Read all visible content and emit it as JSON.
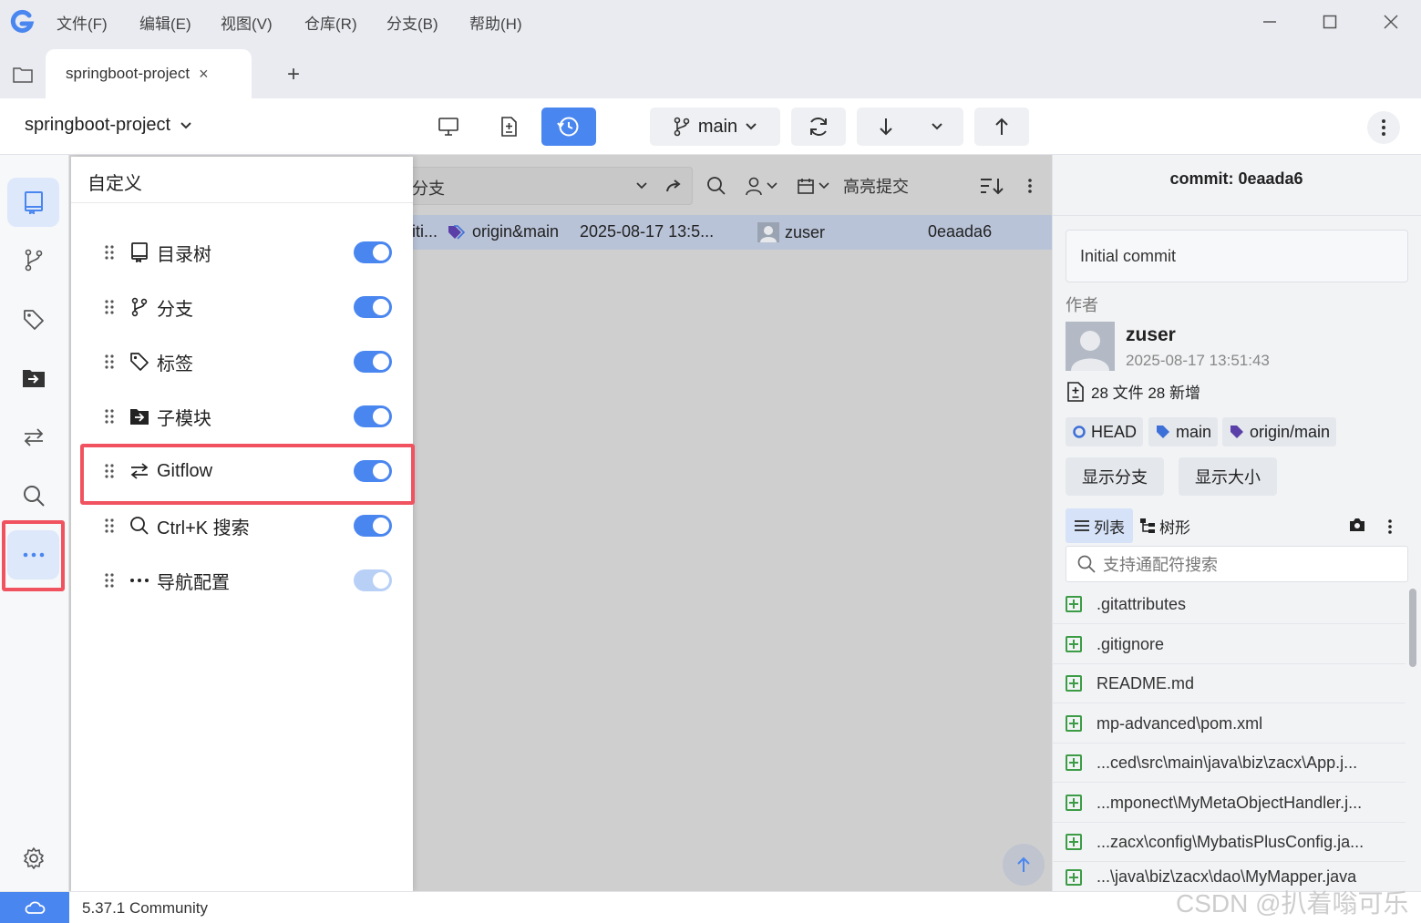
{
  "menu": [
    "文件(F)",
    "编辑(E)",
    "视图(V)",
    "仓库(R)",
    "分支(B)",
    "帮助(H)"
  ],
  "tab": {
    "title": "springboot-project",
    "close": "×",
    "new": "+"
  },
  "toolbar": {
    "repo": "springboot-project",
    "branch": "main"
  },
  "customize": {
    "title": "自定义",
    "items": [
      {
        "label": "目录树",
        "enabled": true
      },
      {
        "label": "分支",
        "enabled": true
      },
      {
        "label": "标签",
        "enabled": true
      },
      {
        "label": "子模块",
        "enabled": true
      },
      {
        "label": "Gitflow",
        "enabled": true
      },
      {
        "label": "Ctrl+K 搜索",
        "enabled": true
      },
      {
        "label": "导航配置",
        "enabled": true,
        "locked": true
      }
    ]
  },
  "filter": {
    "label": "分支",
    "highlight": "高亮提交"
  },
  "commit_row": {
    "message": "iti...",
    "refs": "origin&main",
    "date": "2025-08-17 13:5...",
    "author": "zuser",
    "hash": "0eaada6"
  },
  "detail": {
    "header": "commit: 0eaada6",
    "message": "Initial commit",
    "author_label": "作者",
    "author": "zuser",
    "date": "2025-08-17 13:51:43",
    "summary": "28 文件 28 新增",
    "refs": [
      "HEAD",
      "main",
      "origin/main"
    ],
    "btn_branches": "显示分支",
    "btn_size": "显示大小",
    "view_list": "列表",
    "view_tree": "树形",
    "search_placeholder": "支持通配符搜索",
    "files": [
      ".gitattributes",
      ".gitignore",
      "README.md",
      "mp-advanced\\pom.xml",
      "...ced\\src\\main\\java\\biz\\zacx\\App.j...",
      "...mponect\\MyMetaObjectHandler.j...",
      "...zacx\\config\\MybatisPlusConfig.ja...",
      "...\\java\\biz\\zacx\\dao\\MyMapper.java"
    ]
  },
  "status": {
    "version": "5.37.1 Community",
    "watermark": "CSDN @扒着嗡可乐"
  },
  "colors": {
    "accent": "#4a86f0",
    "highlight": "#f0535f",
    "add": "#3c9c46"
  }
}
